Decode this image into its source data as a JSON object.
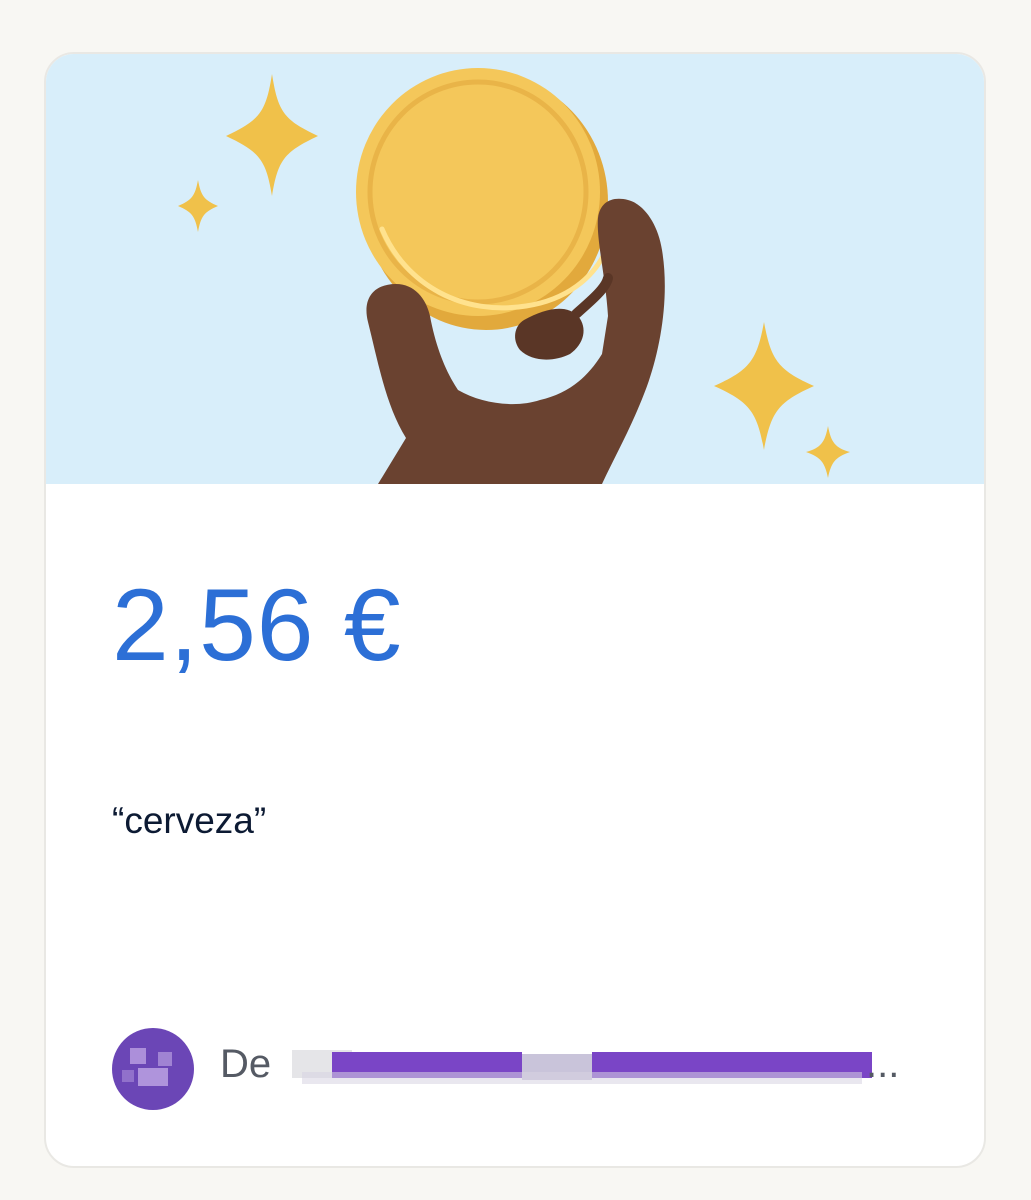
{
  "payment": {
    "amount": "2,56 €",
    "message": "“cerveza”",
    "sender_prefix": "De",
    "sender_name_redacted": true,
    "sender_suffix": "..."
  },
  "colors": {
    "amount": "#2c6fd6",
    "hero_background": "#d8eefa",
    "coin": "#f4c75a",
    "coin_edge": "#e2a93c",
    "hand": "#6a4230",
    "sparkle": "#f0c14a",
    "avatar": "#6b46b6",
    "redaction": "#7a45c6"
  },
  "icons": {
    "hero_illustration": "hand-holding-coin-illustration",
    "sparkles": "sparkle-icon",
    "avatar": "avatar"
  }
}
